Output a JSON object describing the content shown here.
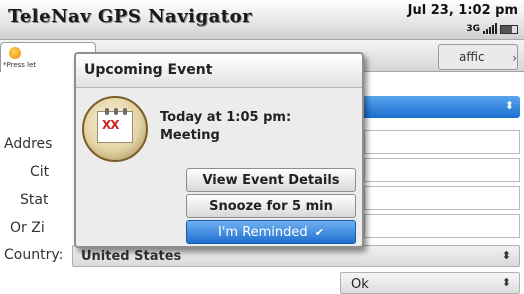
{
  "titlebar": {
    "app_title": "TeleNav GPS Navigator",
    "clock": "Jul 23, 1:02 pm",
    "network": "3G",
    "battery_icon": "battery-icon",
    "signal_icon": "signal-icon"
  },
  "tabs": {
    "active_icon": "navigation-tab-icon",
    "hint": "*Press let",
    "traffic_label": "affic"
  },
  "form": {
    "labels": [
      "Addres",
      "Cit",
      "Stat",
      "Or Zi"
    ],
    "country_label": "Country:",
    "country_value": "United States",
    "ok_label": "Ok"
  },
  "dialog": {
    "title": "Upcoming Event",
    "event_icon": "calendar-event-icon",
    "calendar_mark": "XX",
    "event_time": "Today at 1:05 pm:",
    "event_name": "Meeting",
    "buttons": {
      "view_details": "View Event Details",
      "snooze": "Snooze for 5 min",
      "reminded": "I'm Reminded"
    },
    "reminded_icon": "checkmark-icon"
  },
  "colors": {
    "accent_blue": "#1f6fd2",
    "calendar_red": "#d02020"
  }
}
